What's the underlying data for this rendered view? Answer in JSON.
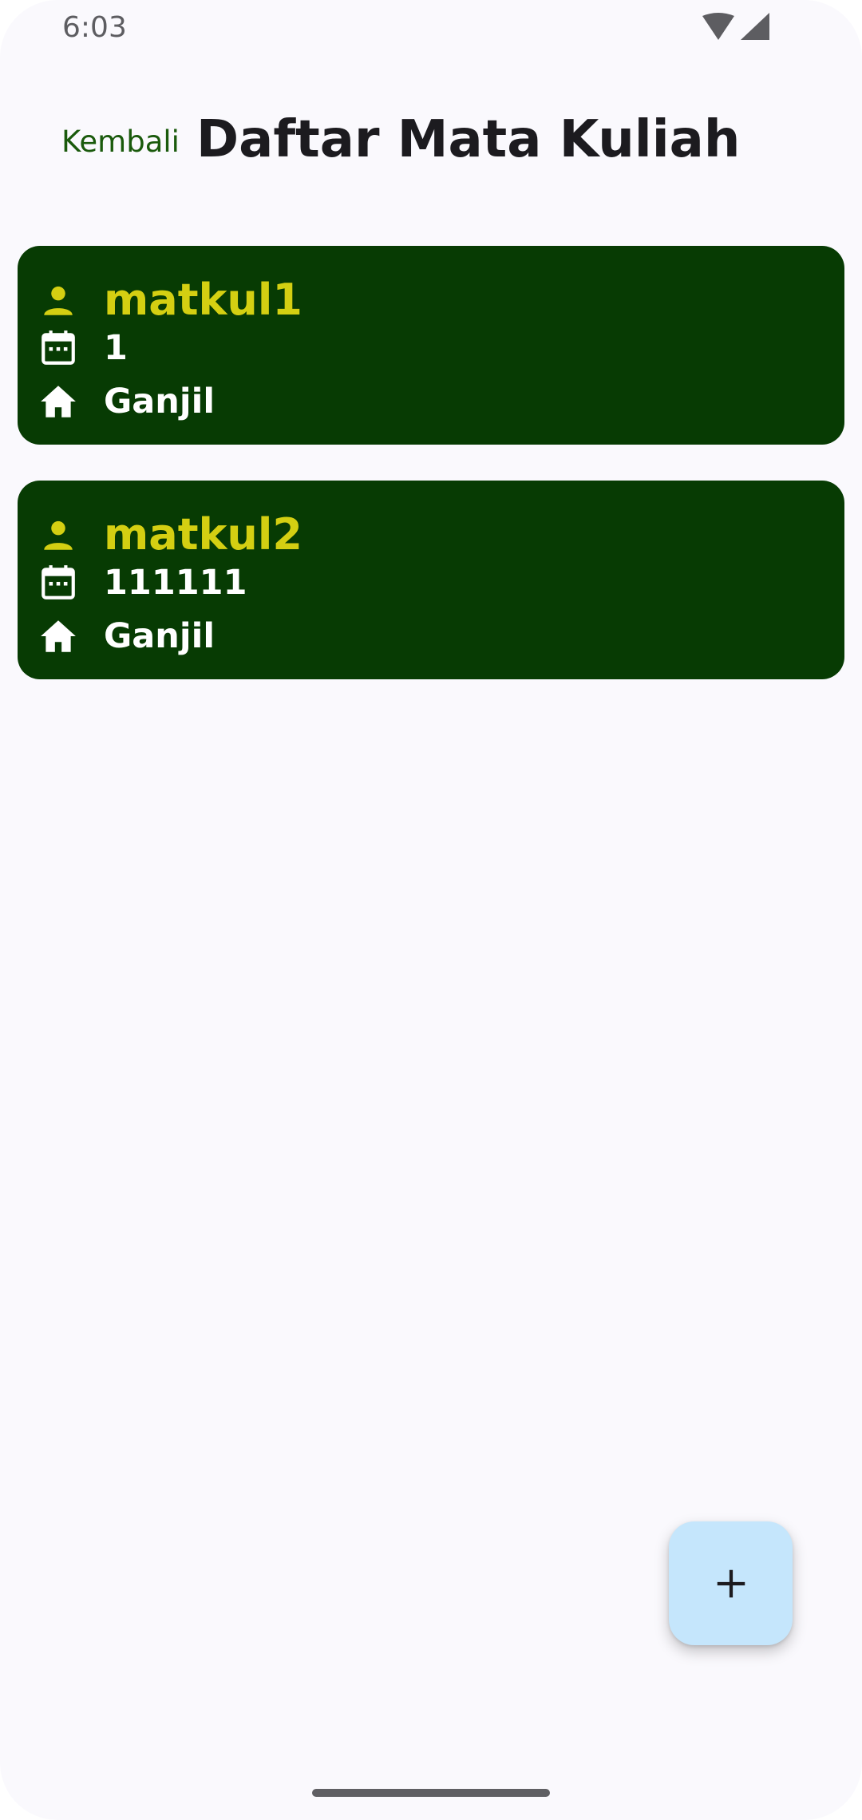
{
  "status_bar": {
    "time": "6:03",
    "icons": [
      "wifi-icon",
      "cellular-signal-icon"
    ]
  },
  "header": {
    "back_label": "Kembali",
    "title": "Daftar Mata Kuliah"
  },
  "courses": [
    {
      "name": "matkul1",
      "code": "1",
      "semester": "Ganjil",
      "icons": [
        "person-icon",
        "calendar-icon",
        "home-icon"
      ]
    },
    {
      "name": "matkul2",
      "code": "111111",
      "semester": "Ganjil",
      "icons": [
        "person-icon",
        "calendar-icon",
        "home-icon"
      ]
    }
  ],
  "fab": {
    "icon": "plus-icon"
  },
  "colors": {
    "background": "#faf9fd",
    "card_background": "#073b03",
    "course_name": "#d4cf12",
    "card_text": "#ffffff",
    "back_link": "#1a5a0c",
    "fab_background": "#c5e6fc"
  }
}
